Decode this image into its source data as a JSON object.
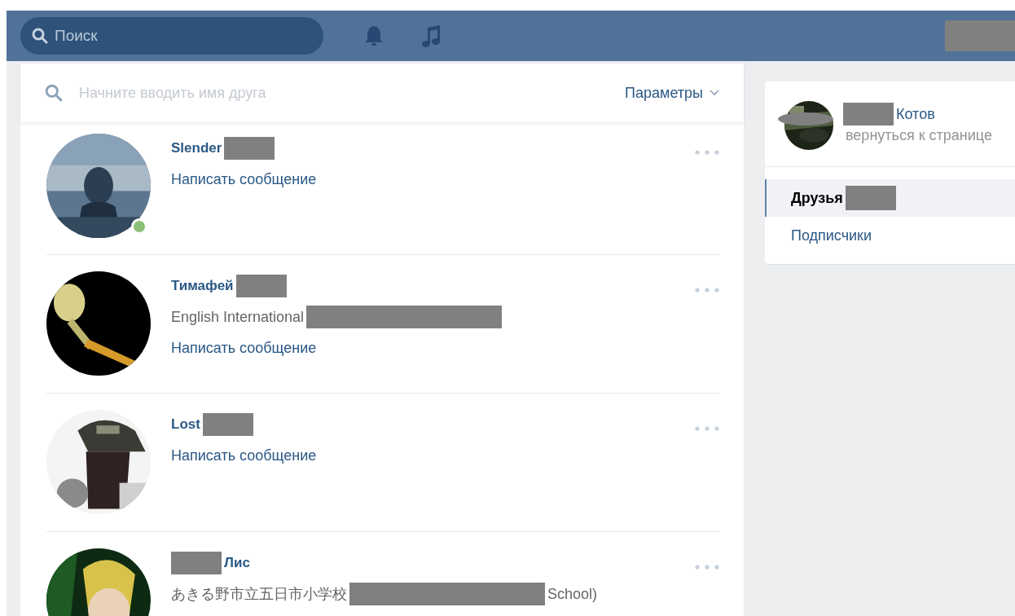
{
  "header": {
    "search": {
      "placeholder": "Поиск"
    },
    "account_redacted": true
  },
  "friends_search": {
    "placeholder": "Начните вводить имя друга",
    "filter_button": "Параметры"
  },
  "friends": [
    {
      "name": [
        {
          "kind": "text",
          "text": "Slender"
        },
        {
          "kind": "redacted"
        }
      ],
      "online": true,
      "message": "Написать сообщение"
    },
    {
      "name": [
        {
          "kind": "text",
          "text": "Тимафей"
        },
        {
          "kind": "redacted"
        }
      ],
      "online": false,
      "subtitle": [
        {
          "kind": "text",
          "text": "English International"
        },
        {
          "kind": "redacted"
        }
      ],
      "message": "Написать сообщение"
    },
    {
      "name": [
        {
          "kind": "text",
          "text": "Lost"
        },
        {
          "kind": "redacted"
        }
      ],
      "online": false,
      "message": "Написать сообщение"
    },
    {
      "name": [
        {
          "kind": "redacted"
        },
        {
          "kind": "text",
          "text": "Лис"
        }
      ],
      "online": false,
      "subtitle": [
        {
          "kind": "text",
          "text": "あきる野市立五日市小学校"
        },
        {
          "kind": "redacted"
        },
        {
          "kind": "text",
          "text": "School)"
        }
      ]
    }
  ],
  "profile": {
    "name": [
      {
        "kind": "redacted"
      },
      {
        "kind": "text",
        "text": "Котов"
      }
    ],
    "back_link": "вернуться к странице",
    "avatar_redacted": true
  },
  "menu": [
    {
      "label": [
        {
          "kind": "text",
          "text": "Друзья"
        },
        {
          "kind": "redacted"
        }
      ],
      "selected": true
    },
    {
      "label": [
        {
          "kind": "text",
          "text": "Подписчики"
        }
      ],
      "selected": false
    }
  ]
}
